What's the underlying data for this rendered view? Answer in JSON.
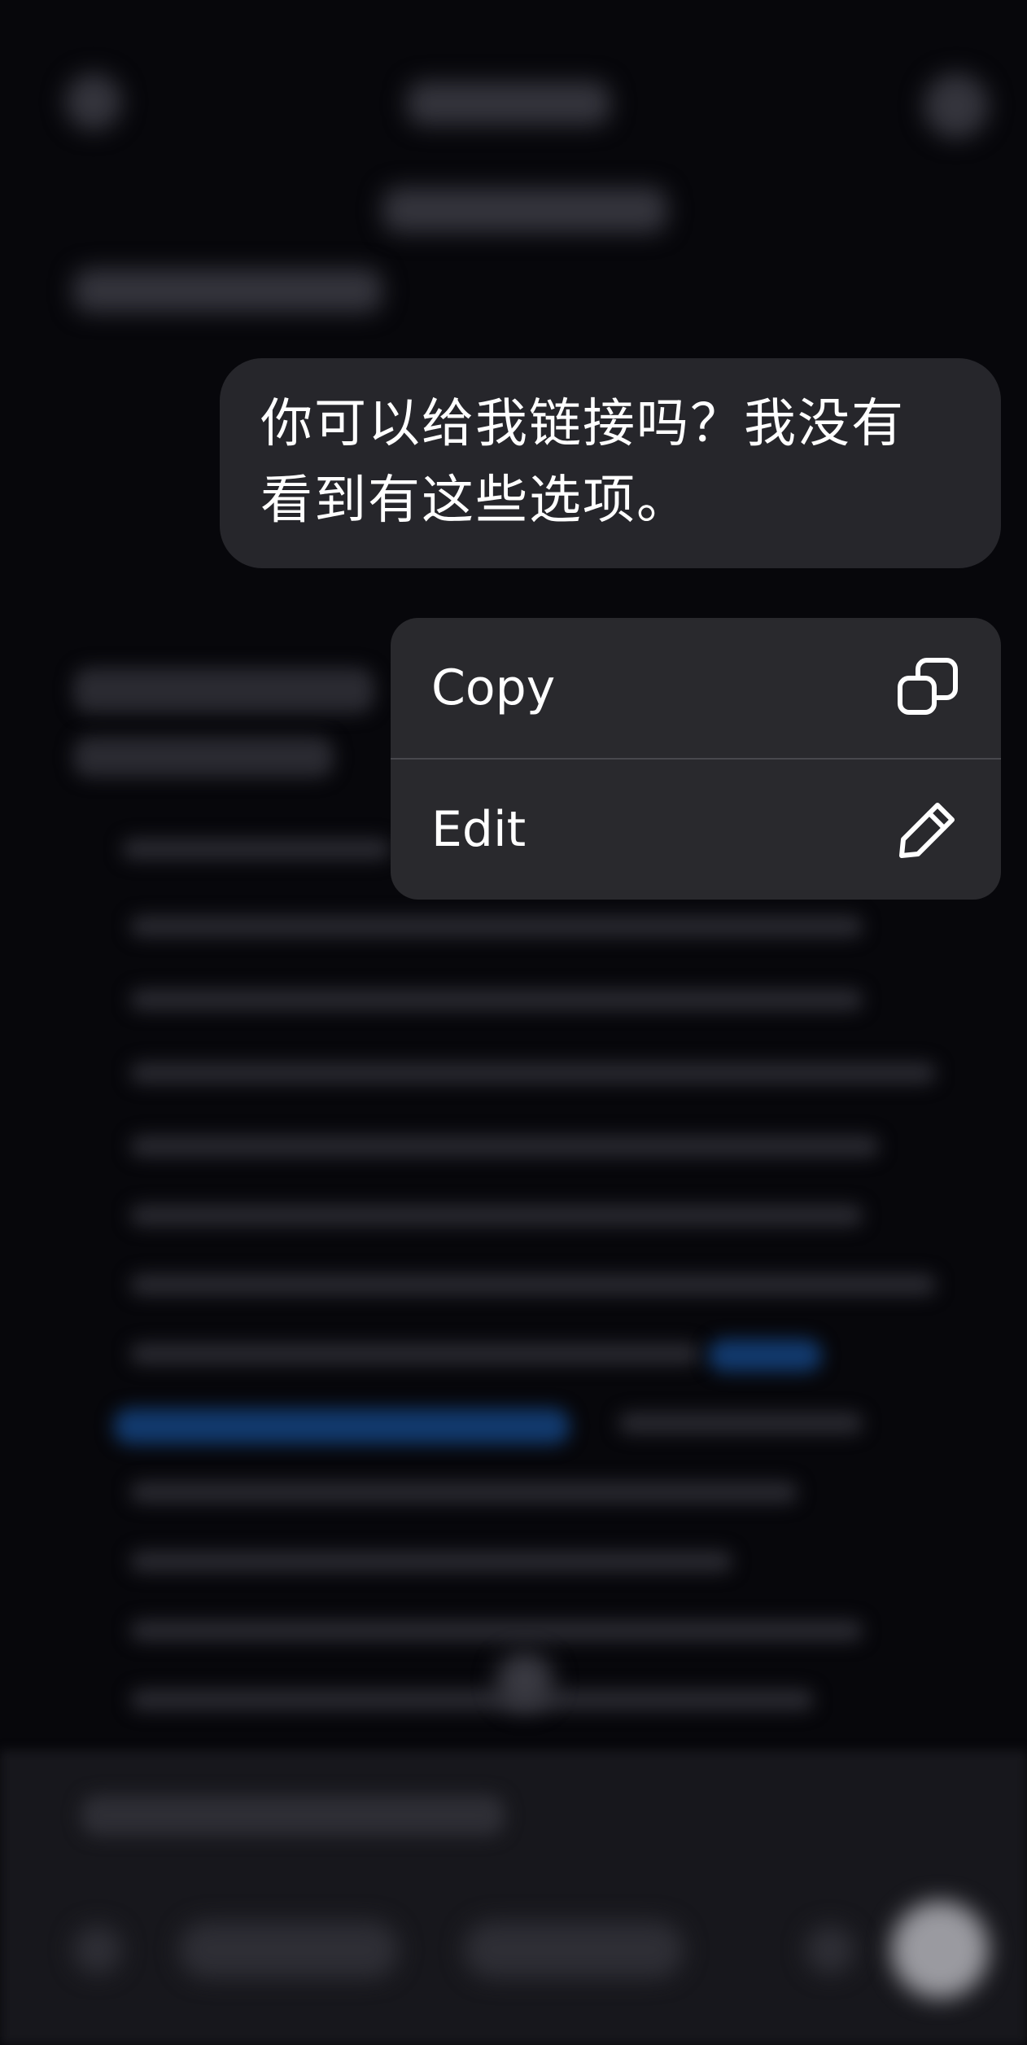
{
  "message": {
    "text_line1": "你可以给我链接吗？我没有",
    "text_line2": "看到有这些选项。"
  },
  "context_menu": {
    "items": [
      {
        "label": "Copy",
        "icon": "copy-icon"
      },
      {
        "label": "Edit",
        "icon": "pencil-icon"
      }
    ]
  },
  "colors": {
    "background": "#07070b",
    "bubble": "#26262b",
    "menu": "#29292d",
    "divider": "#48484d",
    "text": "#ffffff"
  }
}
